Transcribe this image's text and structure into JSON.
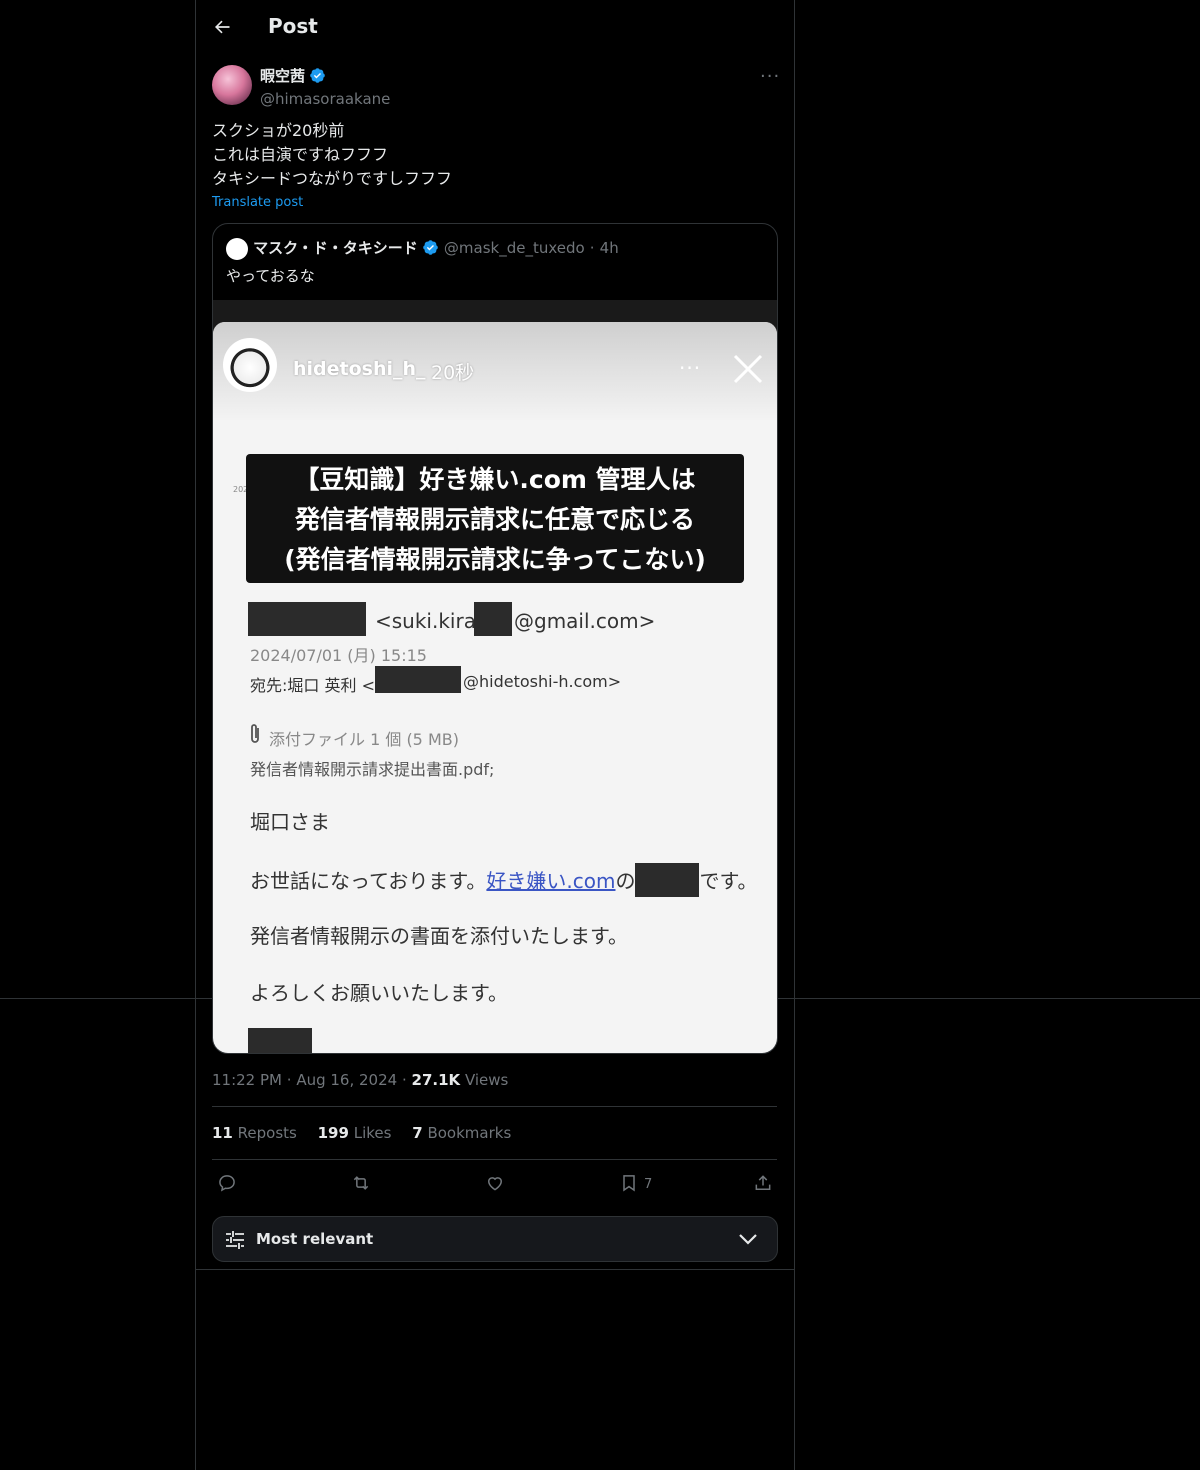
{
  "header": {
    "title": "Post"
  },
  "author": {
    "name": "暇空茜",
    "handle": "@himasoraakane"
  },
  "post": {
    "text": "スクショが20秒前\nこれは自演ですねフフフ\nタキシードつながりですしフフフ",
    "translate": "Translate post"
  },
  "quote": {
    "name": "マスク・ド・タキシード",
    "handle": "@mask_de_tuxedo",
    "time": "4h",
    "text": "やっておるな",
    "image": {
      "story_user": "hidetoshi_h_",
      "story_time": "20秒",
      "date_stub": "202",
      "banner_lines": [
        "【豆知識】好き嫌い.com 管理人は",
        "発信者情報開示請求に任意で応じる",
        "(発信者情報開示請求に争ってこない)"
      ],
      "from_prefix": "<suki.kira.",
      "from_suffix": "@gmail.com>",
      "date": "2024/07/01 (月) 15:15",
      "to_prefix": "宛先:堀口 英利 <",
      "to_suffix": "@hidetoshi-h.com>",
      "attach_label": "添付ファイル 1 個 (5 MB)",
      "attach_file": "発信者情報開示請求提出書面.pdf;",
      "greeting": "堀口さま",
      "line1_prefix": "お世話になっております。",
      "line1_link": "好き嫌い.com",
      "line1_mid": "の",
      "line1_suffix": "です。",
      "line2": "発信者情報開示の書面を添付いたします。",
      "line3": "よろしくお願いいたします。"
    }
  },
  "meta": {
    "time": "11:22 PM",
    "date": "Aug 16, 2024",
    "views_count": "27.1K",
    "views_label": "Views"
  },
  "stats": {
    "reposts_count": "11",
    "reposts_label": "Reposts",
    "likes_count": "199",
    "likes_label": "Likes",
    "bookmarks_count": "7",
    "bookmarks_label": "Bookmarks"
  },
  "actions": {
    "bookmark_count": "7"
  },
  "sort": {
    "label": "Most relevant"
  },
  "colors": {
    "accent": "#1d9bf0",
    "border": "#2f3336",
    "muted": "#71767b"
  }
}
